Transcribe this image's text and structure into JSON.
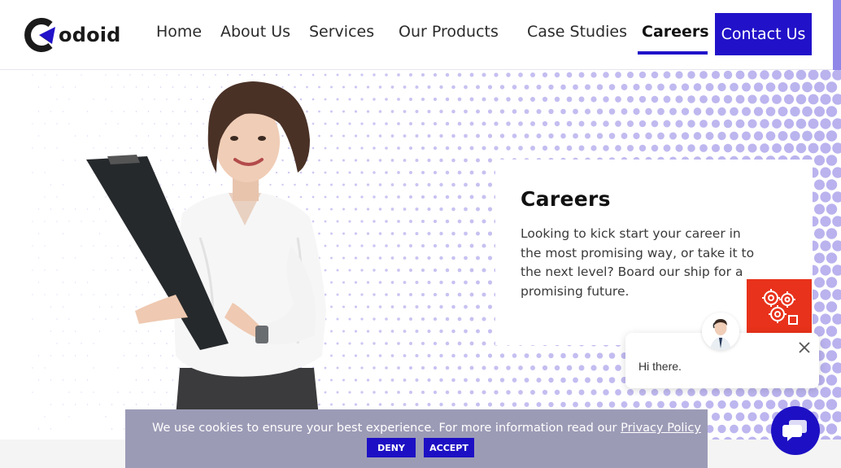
{
  "header": {
    "logo_text": "odoid",
    "logo_alt": "Codoid",
    "nav": {
      "home": "Home",
      "about": "About Us",
      "services": "Services",
      "products": "Our Products",
      "case_studies": "Case Studies",
      "careers": "Careers"
    },
    "contact_label": "Contact Us",
    "active_item": "Careers"
  },
  "hero": {
    "title": "Careers",
    "text": "Looking to kick start your career in the most promising way, or take it to the next level? Board our ship for a promising future."
  },
  "chat": {
    "greeting": "Hi there.",
    "close_icon": "close-icon",
    "launcher_icon": "chat-bubble-icon"
  },
  "cookie": {
    "text": "We use cookies to ensure your best experience. For more information read our ",
    "link": "Privacy Policy",
    "deny_label": "DENY",
    "accept_label": "ACCEPT"
  },
  "colors": {
    "brand": "#2112c9",
    "dots": "#b9b2ee",
    "badge": "#e8321b",
    "cookie_bg": "#9c9bb6"
  }
}
